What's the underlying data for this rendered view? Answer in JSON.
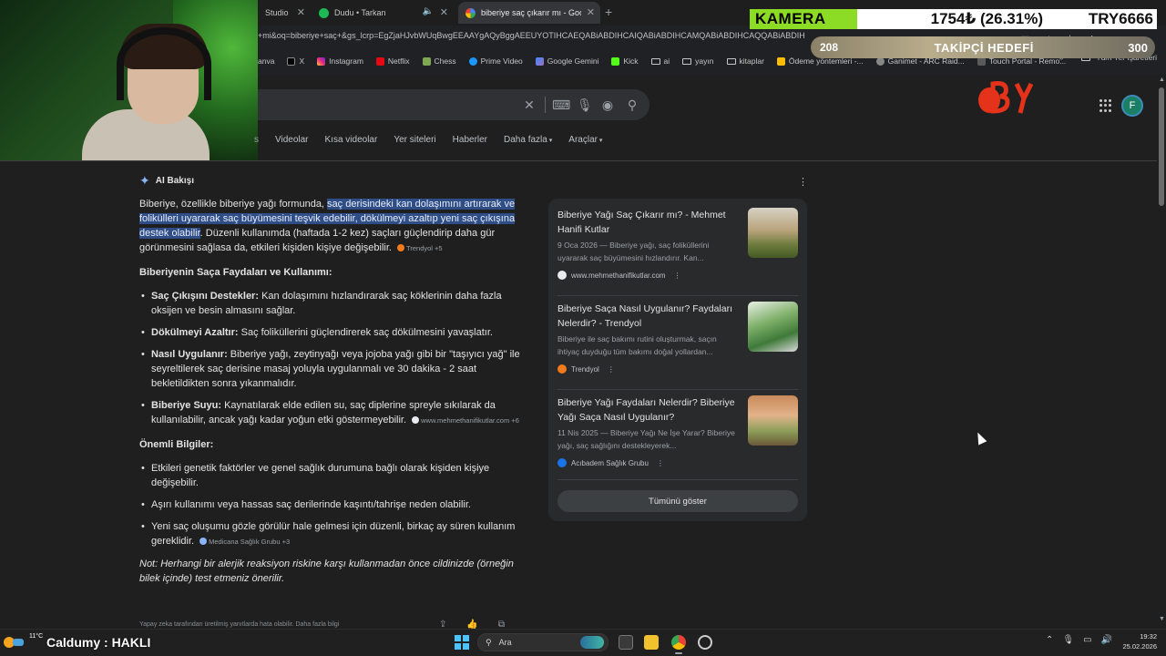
{
  "browser": {
    "tabs": [
      {
        "label": "Studio",
        "active": false
      },
      {
        "label": "Dudu • Tarkan",
        "active": false,
        "has_audio": true
      },
      {
        "label": "biberiye saç çıkarır mı - Google",
        "active": true
      }
    ],
    "url_text": "+mi&oq=biberiye+saç+&gs_lcrp=EgZjaHJvbWUqBwgEEAAYgAQyBggAEEUYOTIHCAEQABiABDIHCAIQABiABDIHCAMQABiABDIHCAQQABiABDIHCAUQABiABDIHCA",
    "bookmarks": [
      "anva",
      "X",
      "Instagram",
      "Netflix",
      "Chess",
      "Prime Video",
      "Google Gemini",
      "Kick",
      "ai",
      "yayın",
      "kitaplar",
      "Ödeme yöntemleri -...",
      "Ganimet - ARC Raid...",
      "Touch Portal - Remo..."
    ],
    "bookmarks_more": "»",
    "all_bookmarks": "Tüm Yer İşaretleri"
  },
  "overlay": {
    "ticker_label": "KAMERA",
    "ticker_price": "1754₺ (26.31%)",
    "ticker_pair": "TRY6666",
    "goal_current": "208",
    "goal_title": "TAKİPÇİ HEDEFİ",
    "goal_target": "300",
    "channel_name": "Caldumy : HAKLI",
    "weather": "11°C"
  },
  "google": {
    "filters": [
      {
        "label": "Videolar",
        "dropdown": false
      },
      {
        "label": "Kısa videolar",
        "dropdown": false
      },
      {
        "label": "Yer siteleri",
        "dropdown": false
      },
      {
        "label": "Haberler",
        "dropdown": false
      },
      {
        "label": "Daha fazla",
        "dropdown": true
      },
      {
        "label": "Araçlar",
        "dropdown": true
      }
    ],
    "avatar_letter": "F",
    "ai": {
      "header": "AI Bakışı",
      "intro_pre": "Biberiye, özellikle biberiye yağı formunda, ",
      "intro_highlight": "saç derisindeki kan dolaşımını artırarak ve folikülleri uyararak saç büyümesini teşvik edebilir, dökülmeyi azaltıp yeni saç çıkışına destek olabilir",
      "intro_post": ". Düzenli kullanımda (haftada 1-2 kez) saçları güçlendirip daha gür görünmesini sağlasa da, etkileri kişiden kişiye değişebilir.",
      "intro_chip": "Trendyol +5",
      "section1_title": "Biberiyenin Saça Faydaları ve Kullanımı:",
      "section1_items": [
        {
          "bold": "Saç Çıkışını Destekler:",
          "text": " Kan dolaşımını hızlandırarak saç köklerinin daha fazla oksijen ve besin almasını sağlar."
        },
        {
          "bold": "Dökülmeyi Azaltır:",
          "text": " Saç foliküllerini güçlendirerek saç dökülmesini yavaşlatır."
        },
        {
          "bold": "Nasıl Uygulanır:",
          "text": " Biberiye yağı, zeytinyağı veya jojoba yağı gibi bir \"taşıyıcı yağ\" ile seyreltilerek saç derisine masaj yoluyla uygulanmalı ve 30 dakika - 2 saat bekletildikten sonra yıkanmalıdır."
        },
        {
          "bold": "Biberiye Suyu:",
          "text": " Kaynatılarak elde edilen su, saç diplerine spreyle sıkılarak da kullanılabilir, ancak yağı kadar yoğun etki göstermeyebilir.",
          "chip": "www.mehmethanifikutlar.com +6"
        }
      ],
      "section2_title": "Önemli Bilgiler:",
      "section2_items": [
        {
          "text": "Etkileri genetik faktörler ve genel sağlık durumuna bağlı olarak kişiden kişiye değişebilir."
        },
        {
          "text": "Aşırı kullanımı veya hassas saç derilerinde kaşıntı/tahrişe neden olabilir."
        },
        {
          "text": "Yeni saç oluşumu gözle görülür hale gelmesi için düzenli, birkaç ay süren kullanım gereklidir.",
          "chip": "Medicana Sağlık Grubu +3"
        }
      ],
      "note": "Not: Herhangi bir alerjik reaksiyon riskine karşı kullanmadan önce cildinizde (örneğin bilek içinde) test etmeniz önerilir.",
      "footer": "Yapay zeka tarafından üretilmiş yanıtlarda hata olabilir. Daha fazla bilgi"
    },
    "sources": [
      {
        "title": "Biberiye Yağı Saç Çıkarır mı? - Mehmet Hanifi Kutlar",
        "snippet": "9 Oca 2026 — Biberiye yağı, saç foliküllerini uyararak saç büyümesini hızlandırır. Kan...",
        "site": "www.mehmethanifikutlar.com",
        "fav_color": "#e8eaed"
      },
      {
        "title": "Biberiye Saça Nasıl Uygulanır? Faydaları Nelerdir? - Trendyol",
        "snippet": "Biberiye ile saç bakımı rutini oluşturmak, saçın ihtiyaç duyduğu tüm bakımı doğal yollardan...",
        "site": "Trendyol",
        "fav_color": "#f27a1a"
      },
      {
        "title": "Biberiye Yağı Faydaları Nelerdir? Biberiye Yağı Saça Nasıl Uygulanır?",
        "snippet": "11 Nis 2025 — Biberiye Yağı Ne İşe Yarar? Biberiye yağı, saç sağlığını destekleyerek...",
        "site": "Acıbadem Sağlık Grubu",
        "fav_color": "#1a73e8"
      }
    ],
    "show_all": "Tümünü göster"
  },
  "taskbar": {
    "search_placeholder": "Ara",
    "time": "19:32",
    "date": "25.02.2026"
  }
}
